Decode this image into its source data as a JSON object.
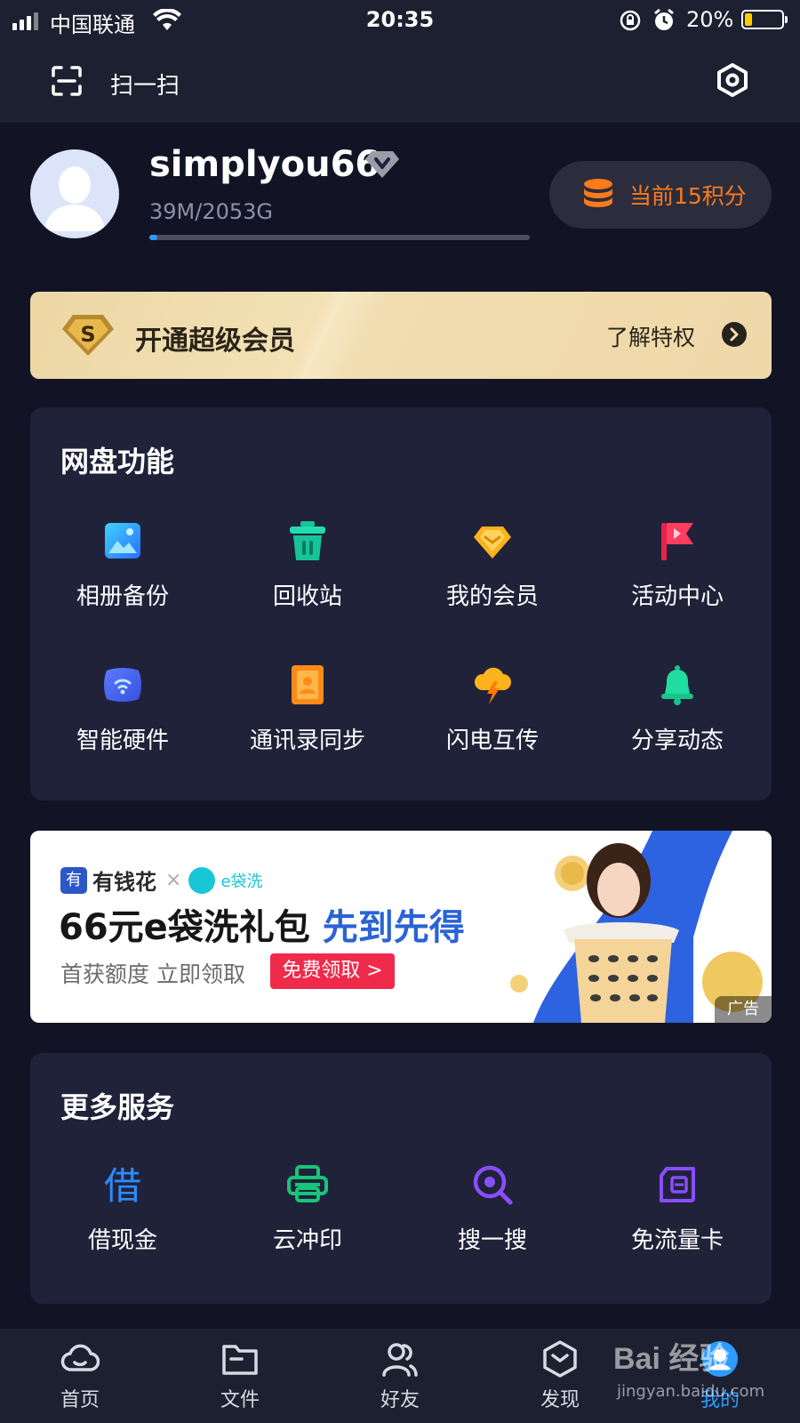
{
  "status_bar": {
    "carrier": "中国联通",
    "time": "20:35",
    "battery_percent": "20%",
    "battery_level": 0.2
  },
  "top_bar": {
    "scan_label": "扫一扫",
    "settings_icon": "settings-hexagon-icon"
  },
  "profile": {
    "username": "simplyou66",
    "storage_text": "39M/2053G",
    "storage_used_fraction": 0.02,
    "points_label": "当前15积分",
    "colors": {
      "points": "#ff7a1a",
      "progress": "#2d9bff"
    }
  },
  "vip": {
    "title": "开通超级会员",
    "link": "了解特权",
    "badge_letter": "S"
  },
  "features": {
    "title": "网盘功能",
    "items": [
      {
        "label": "相册备份",
        "icon": "photo-backup-icon"
      },
      {
        "label": "回收站",
        "icon": "trash-icon"
      },
      {
        "label": "我的会员",
        "icon": "vip-diamond-icon"
      },
      {
        "label": "活动中心",
        "icon": "flag-icon"
      },
      {
        "label": "智能硬件",
        "icon": "smart-hardware-icon"
      },
      {
        "label": "通讯录同步",
        "icon": "contacts-icon"
      },
      {
        "label": "闪电互传",
        "icon": "lightning-transfer-icon"
      },
      {
        "label": "分享动态",
        "icon": "bell-icon"
      }
    ]
  },
  "ad": {
    "brand1": "有钱花",
    "brand1_logo_char": "有",
    "separator": "×",
    "brand2": "e袋洗",
    "headline_main": "66元e袋洗礼包",
    "headline_highlight": "先到先得",
    "subtext": "首获额度 立即领取",
    "cta": "免费领取 >",
    "tag": "广告"
  },
  "services": {
    "title": "更多服务",
    "items": [
      {
        "label": "借现金",
        "icon": "borrow-icon",
        "glyph": "借"
      },
      {
        "label": "云冲印",
        "icon": "printer-icon"
      },
      {
        "label": "搜一搜",
        "icon": "search-icon"
      },
      {
        "label": "免流量卡",
        "icon": "sim-card-icon"
      }
    ]
  },
  "tab_bar": {
    "tabs": [
      {
        "label": "首页",
        "icon": "cloud-icon"
      },
      {
        "label": "文件",
        "icon": "folder-icon"
      },
      {
        "label": "好友",
        "icon": "friends-icon"
      },
      {
        "label": "发现",
        "icon": "discover-icon"
      },
      {
        "label": "我的",
        "icon": "profile-icon",
        "active": true
      }
    ]
  },
  "watermark": {
    "top": "Bai 经验",
    "bottom": "jingyan.baidu.com"
  }
}
